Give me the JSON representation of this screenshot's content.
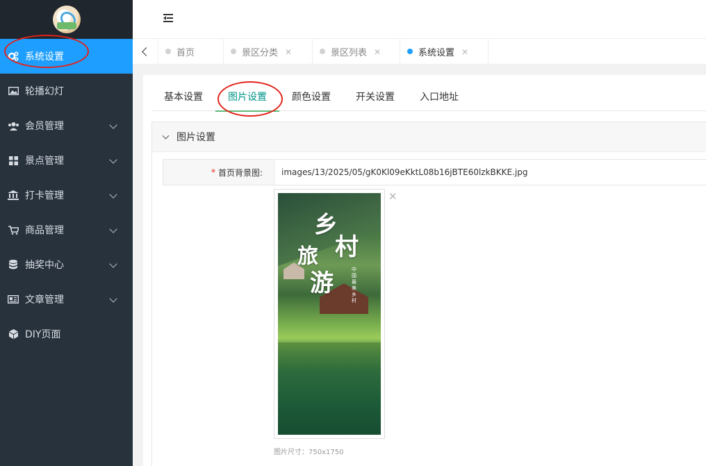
{
  "sidebar": {
    "items": [
      {
        "label": "系统设置",
        "icon": "gears-icon",
        "active": true,
        "has_children": false
      },
      {
        "label": "轮播幻灯",
        "icon": "image-icon",
        "active": false,
        "has_children": false
      },
      {
        "label": "会员管理",
        "icon": "users-icon",
        "active": false,
        "has_children": true
      },
      {
        "label": "景点管理",
        "icon": "grid-icon",
        "active": false,
        "has_children": true
      },
      {
        "label": "打卡管理",
        "icon": "bank-icon",
        "active": false,
        "has_children": true
      },
      {
        "label": "商品管理",
        "icon": "cart-icon",
        "active": false,
        "has_children": true
      },
      {
        "label": "抽奖中心",
        "icon": "database-icon",
        "active": false,
        "has_children": true
      },
      {
        "label": "文章管理",
        "icon": "newspaper-icon",
        "active": false,
        "has_children": true
      },
      {
        "label": "DIY页面",
        "icon": "cube-icon",
        "active": false,
        "has_children": false
      }
    ]
  },
  "tabs": [
    {
      "label": "首页",
      "closable": false,
      "active": false
    },
    {
      "label": "景区分类",
      "closable": true,
      "active": false
    },
    {
      "label": "景区列表",
      "closable": true,
      "active": false
    },
    {
      "label": "系统设置",
      "closable": true,
      "active": true
    }
  ],
  "subtabs": [
    {
      "label": "基本设置",
      "active": false
    },
    {
      "label": "图片设置",
      "active": true
    },
    {
      "label": "颜色设置",
      "active": false
    },
    {
      "label": "开关设置",
      "active": false
    },
    {
      "label": "入口地址",
      "active": false
    }
  ],
  "panel": {
    "title": "图片设置",
    "field_label": "首页背景图:",
    "field_value": "images/13/2025/05/gK0Kl09eKktL08b16jBTE60lzkBKKE.jpg",
    "image_caption": "图片尺寸：750x1750",
    "poster_text": {
      "c1": "乡",
      "c2": "村",
      "c3": "旅",
      "c4": "游",
      "sub": "中国最美乡村"
    }
  },
  "colors": {
    "accent": "#1e9fff",
    "sidebar_bg": "#28323d",
    "active_subtab": "#009688",
    "annotation": "#e2231a"
  }
}
